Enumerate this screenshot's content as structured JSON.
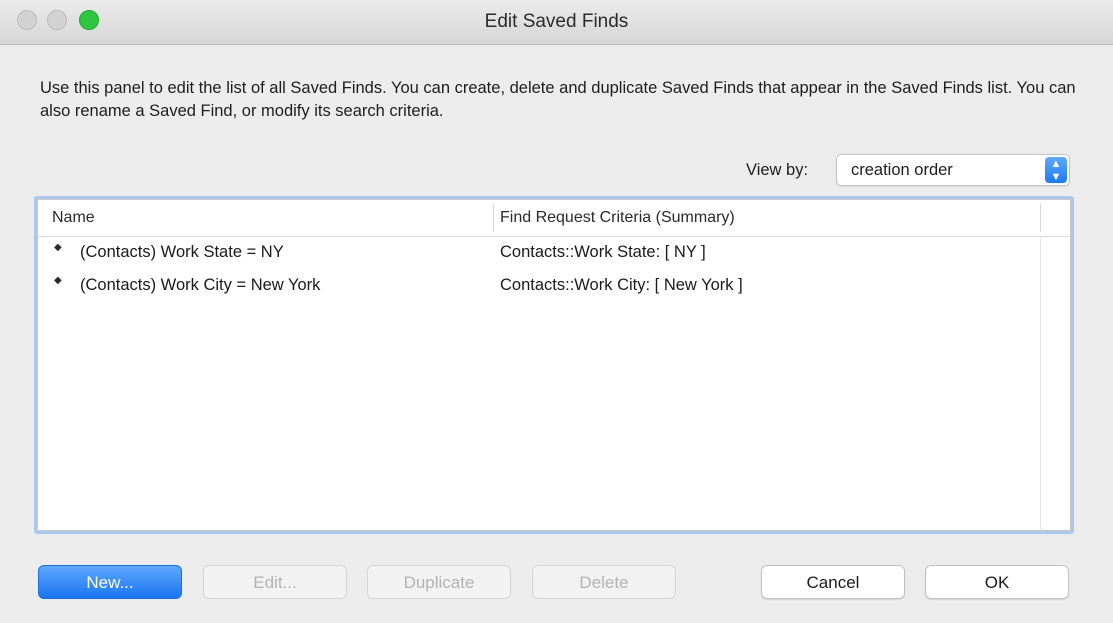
{
  "window": {
    "title": "Edit Saved Finds"
  },
  "description": "Use this panel to edit the list of all Saved Finds. You can create, delete and duplicate Saved Finds that appear in the Saved Finds list.  You can also rename a Saved Find, or modify its search criteria.",
  "view_by": {
    "label": "View by:",
    "selected": "creation order",
    "stepper_up": "▲",
    "stepper_down": "▼"
  },
  "list": {
    "columns": [
      "Name",
      "Find Request Criteria (Summary)"
    ],
    "rows": [
      {
        "handle": "◆",
        "name": "(Contacts) Work State = NY",
        "criteria": "Contacts::Work State: [ NY ]"
      },
      {
        "handle": "◆",
        "name": "(Contacts) Work City = New York",
        "criteria": "Contacts::Work City: [ New York ]"
      }
    ]
  },
  "buttons": {
    "new": "New...",
    "edit": "Edit...",
    "duplicate": "Duplicate",
    "delete": "Delete",
    "cancel": "Cancel",
    "ok": "OK"
  },
  "colors": {
    "accent": "#1a76f0",
    "zoom_button": "#2fc63f",
    "list_focus_ring": "#a9c8ec"
  }
}
